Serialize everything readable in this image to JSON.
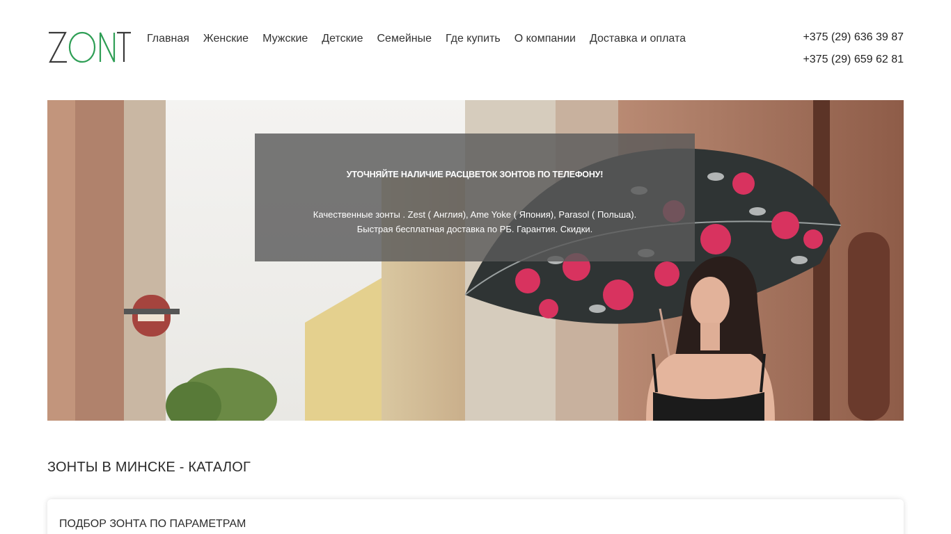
{
  "brand": {
    "name": "ZONT",
    "logo_colors": {
      "z_and_t": "#333333",
      "on": "#2e9e55"
    }
  },
  "nav": {
    "items": [
      {
        "label": "Главная"
      },
      {
        "label": "Женские"
      },
      {
        "label": "Мужские"
      },
      {
        "label": "Детские"
      },
      {
        "label": "Семейные"
      },
      {
        "label": "Где купить"
      },
      {
        "label": "О компании"
      },
      {
        "label": "Доставка и оплата"
      }
    ]
  },
  "contacts": {
    "phone_1": "+375 (29) 636 39 87",
    "phone_2": "+375 (29) 659 62 81"
  },
  "hero": {
    "title": "УТОЧНЯЙТЕ НАЛИЧИЕ РАСЦВЕТОК ЗОНТОВ ПО ТЕЛЕФОНУ!",
    "line_1": "Качественные зонты . Zest ( Англия), Ame Yoke ( Япония), Parasol ( Польша).",
    "line_2": "Быстрая бесплатная доставка по РБ. Гарантия. Скидки."
  },
  "catalog": {
    "title": "ЗОНТЫ В МИНСКЕ - КАТАЛОГ"
  },
  "filter": {
    "title": "ПОДБОР ЗОНТА ПО ПАРАМЕТРАМ"
  }
}
